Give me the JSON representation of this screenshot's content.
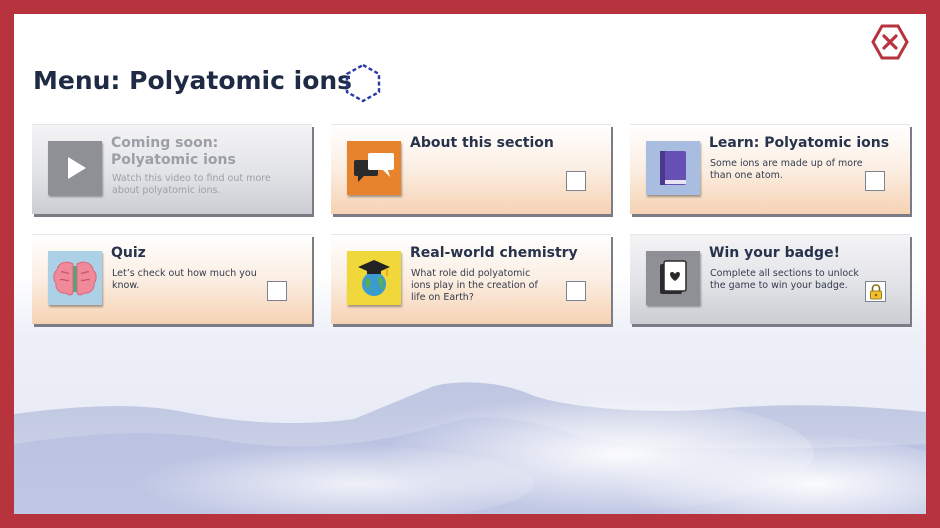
{
  "page": {
    "title": "Menu: Polyatomic ions",
    "title_icon": "hexagon-outline-icon",
    "close_icon": "close-icon",
    "colors": {
      "frame": "#b7343f",
      "title": "#1f2b45",
      "hexagon": "#2b3aa6"
    }
  },
  "cards": [
    {
      "title": "Coming soon: Polyatomic ions",
      "title_line1": "Coming soon:",
      "title_line2": "Polyatomic ions",
      "description": "Watch this video to find out more about polyatomic ions.",
      "icon": "play-icon",
      "state": "disabled"
    },
    {
      "title": "About this section",
      "description": "",
      "icon": "speech-bubbles-icon",
      "state": "unchecked"
    },
    {
      "title": "Learn: Polyatomic ions",
      "description": "Some ions are made up of more than one atom.",
      "icon": "book-icon",
      "state": "unchecked"
    },
    {
      "title": "Quiz",
      "description": "Let’s check out how much you know.",
      "icon": "brain-icon",
      "state": "unchecked"
    },
    {
      "title": "Real-world chemistry",
      "description": "What role did polyatomic ions play in the creation of life on Earth?",
      "icon": "graduation-globe-icon",
      "state": "unchecked"
    },
    {
      "title": "Win your badge!",
      "description": "Complete all sections to unlock the game to win your badge.",
      "icon": "badge-card-icon",
      "state": "locked",
      "status_icon": "lock-icon"
    }
  ]
}
